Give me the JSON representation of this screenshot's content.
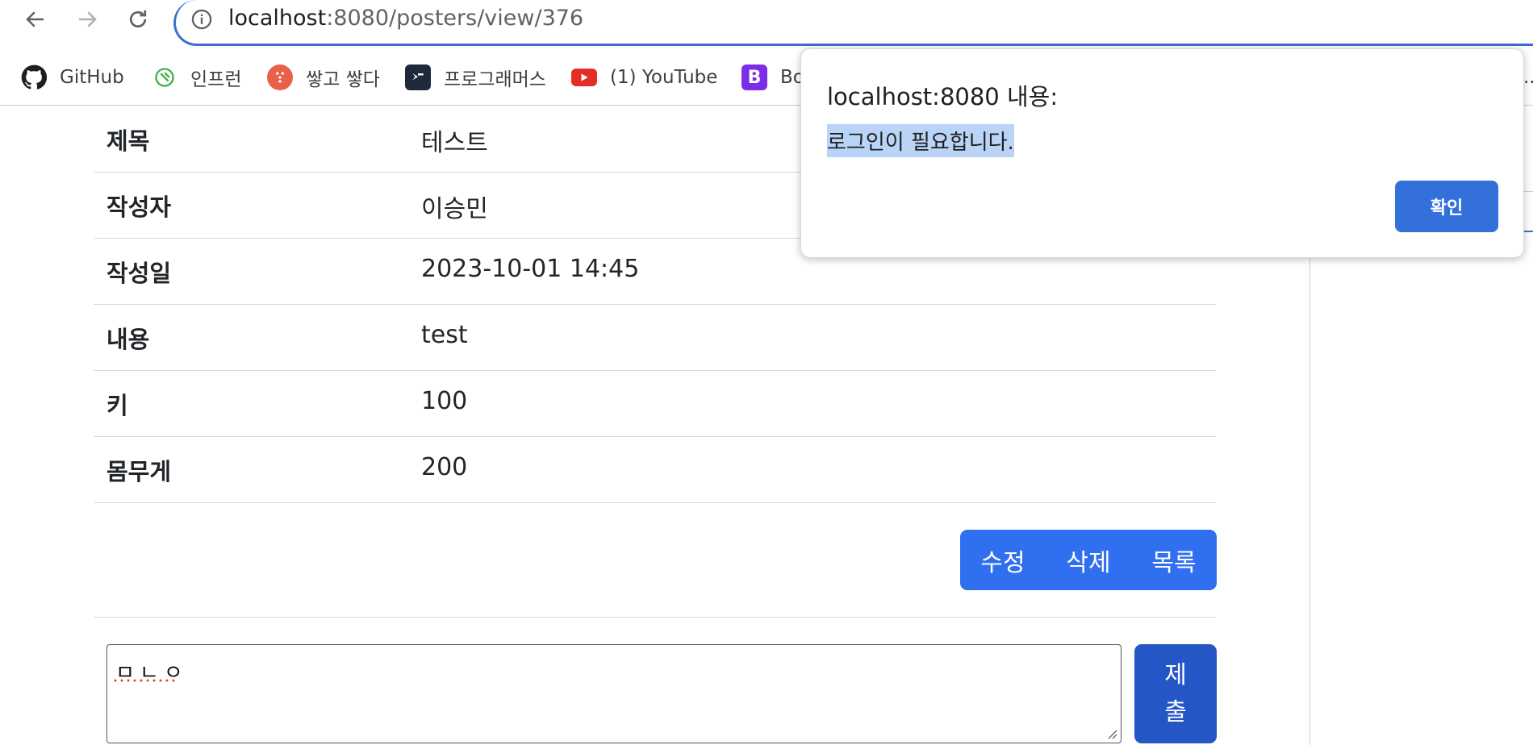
{
  "browser": {
    "url_host": "localhost",
    "url_rest": ":8080/posters/view/376"
  },
  "bookmarks": [
    {
      "label": "GitHub",
      "icon": "github-icon"
    },
    {
      "label": "인프런",
      "icon": "inflearn-icon"
    },
    {
      "label": "쌓고 쌓다",
      "icon": "dots-icon"
    },
    {
      "label": "프로그래머스",
      "icon": "programmers-icon"
    },
    {
      "label": "(1) YouTube",
      "icon": "youtube-icon"
    },
    {
      "label": "Bo",
      "icon": "bootstrap-icon"
    }
  ],
  "overflow_label": "...",
  "post": {
    "rows": [
      {
        "label": "제목",
        "value": "테스트"
      },
      {
        "label": "작성자",
        "value": "이승민"
      },
      {
        "label": "작성일",
        "value": "2023-10-01 14:45"
      },
      {
        "label": "내용",
        "value": "test"
      },
      {
        "label": "키",
        "value": "100"
      },
      {
        "label": "몸무게",
        "value": "200"
      }
    ],
    "actions": {
      "edit_label": "수정",
      "delete_label": "삭제",
      "list_label": "목록"
    }
  },
  "comment": {
    "value": "ㅁㄴㅇ",
    "submit_line1": "제",
    "submit_line2": "출"
  },
  "dialog": {
    "title": "localhost:8080 내용:",
    "message": "로그인이 필요합니다.",
    "ok_label": "확인"
  },
  "colors": {
    "primary": "#2f6ff0",
    "submit": "#2456c5",
    "dialog_button": "#3370da",
    "omnibox_border": "#3c6fd1"
  }
}
